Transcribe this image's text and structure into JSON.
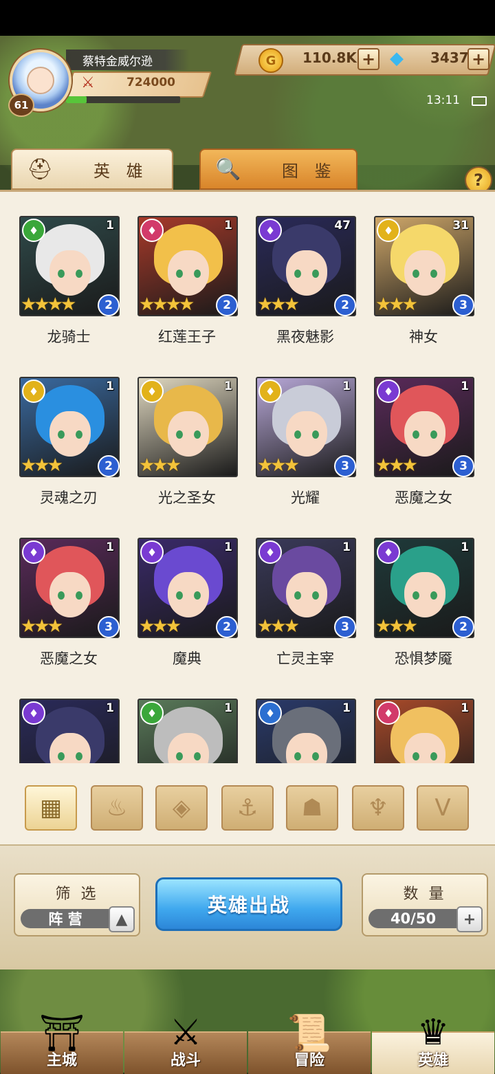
{
  "player": {
    "name": "蔡特金威尔逊",
    "level": "61",
    "power": "724000",
    "exp_fraction": 0.18
  },
  "currency": {
    "gold": "110.8K",
    "gems": "3437",
    "plus": "+"
  },
  "status": {
    "time": "13:11"
  },
  "tabs": [
    {
      "label": "英 雄",
      "icon": "knight-helmet-icon"
    },
    {
      "label": "图 鉴",
      "icon": "magnifier-icon"
    }
  ],
  "help_label": "?",
  "heroes": [
    {
      "name": "龙骑士",
      "level": "1",
      "rank": "2",
      "stars": "★★★★",
      "faction": "beast",
      "faction_color": "#3aa73a"
    },
    {
      "name": "红莲王子",
      "level": "1",
      "rank": "2",
      "stars": "★★★★",
      "faction": "fire",
      "faction_color": "#d23a6a"
    },
    {
      "name": "黑夜魅影",
      "level": "47",
      "rank": "2",
      "stars": "★★★",
      "faction": "dark",
      "faction_color": "#7a3ad2"
    },
    {
      "name": "神女",
      "level": "31",
      "rank": "3",
      "stars": "★★★",
      "faction": "light",
      "faction_color": "#e2b21a"
    },
    {
      "name": "灵魂之刃",
      "level": "1",
      "rank": "2",
      "stars": "★★★",
      "faction": "light",
      "faction_color": "#e2b21a"
    },
    {
      "name": "光之圣女",
      "level": "1",
      "rank": "",
      "stars": "★★★",
      "faction": "light",
      "faction_color": "#e2b21a"
    },
    {
      "name": "光耀",
      "level": "1",
      "rank": "3",
      "stars": "★★★",
      "faction": "light",
      "faction_color": "#e2b21a"
    },
    {
      "name": "恶魔之女",
      "level": "1",
      "rank": "3",
      "stars": "★★★",
      "faction": "dark",
      "faction_color": "#7a3ad2"
    },
    {
      "name": "恶魔之女",
      "level": "1",
      "rank": "3",
      "stars": "★★★",
      "faction": "dark",
      "faction_color": "#7a3ad2"
    },
    {
      "name": "魔典",
      "level": "1",
      "rank": "2",
      "stars": "★★★",
      "faction": "dark",
      "faction_color": "#7a3ad2"
    },
    {
      "name": "亡灵主宰",
      "level": "1",
      "rank": "3",
      "stars": "★★★",
      "faction": "dark",
      "faction_color": "#7a3ad2"
    },
    {
      "name": "恐惧梦魇",
      "level": "1",
      "rank": "2",
      "stars": "★★★",
      "faction": "dark",
      "faction_color": "#7a3ad2"
    },
    {
      "name": "",
      "level": "1",
      "rank": "",
      "stars": "",
      "faction": "dark",
      "faction_color": "#7a3ad2"
    },
    {
      "name": "",
      "level": "1",
      "rank": "",
      "stars": "",
      "faction": "beast",
      "faction_color": "#3aa73a"
    },
    {
      "name": "",
      "level": "1",
      "rank": "",
      "stars": "",
      "faction": "water",
      "faction_color": "#2c6fd1"
    },
    {
      "name": "",
      "level": "1",
      "rank": "",
      "stars": "",
      "faction": "fire",
      "faction_color": "#d23a6a"
    }
  ],
  "filter_tabs": [
    {
      "name": "all",
      "icon": "grid-icon",
      "glyph": "▦"
    },
    {
      "name": "fire",
      "icon": "flame-icon",
      "glyph": "♨"
    },
    {
      "name": "earth",
      "icon": "diamond-icon",
      "glyph": "◈"
    },
    {
      "name": "water",
      "icon": "anchor-icon",
      "glyph": "⚓"
    },
    {
      "name": "beast",
      "icon": "beast-icon",
      "glyph": "☗"
    },
    {
      "name": "dark",
      "icon": "dark-horns-icon",
      "glyph": "♆"
    },
    {
      "name": "light",
      "icon": "light-wings-icon",
      "glyph": "V"
    }
  ],
  "filter_box": {
    "title": "筛 选",
    "value": "阵 营",
    "button": "▲"
  },
  "deploy_button": "英雄出战",
  "count_box": {
    "title": "数 量",
    "value": "40/50",
    "button": "+"
  },
  "nav": [
    {
      "label": "主城",
      "icon": "castle-icon",
      "glyph": "⛩",
      "active": false
    },
    {
      "label": "战斗",
      "icon": "crossed-swords-icon",
      "glyph": "⚔",
      "active": false
    },
    {
      "label": "冒险",
      "icon": "scroll-map-icon",
      "glyph": "📜",
      "active": false
    },
    {
      "label": "英雄",
      "icon": "hero-emblem-icon",
      "glyph": "♛",
      "active": true
    }
  ]
}
